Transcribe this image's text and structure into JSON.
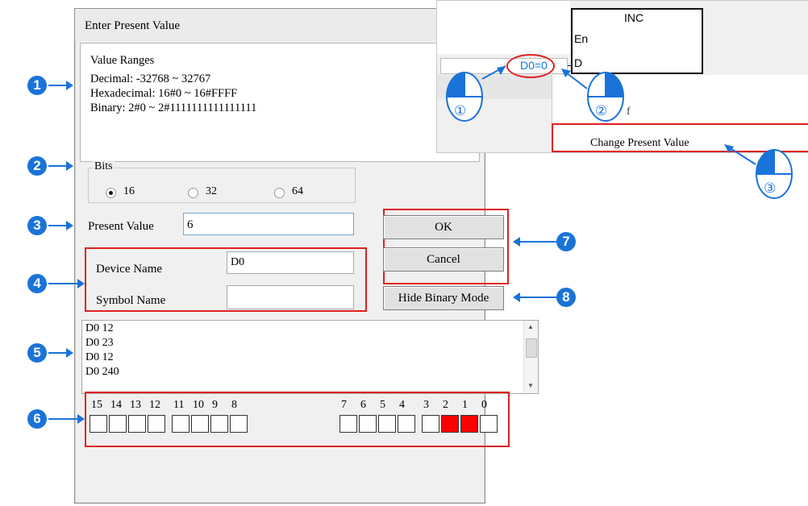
{
  "dialog": {
    "title": "Enter Present Value",
    "value_ranges": {
      "heading": "Value Ranges",
      "decimal": "Decimal: -32768 ~ 32767",
      "hexadecimal": "Hexadecimal: 16#0 ~ 16#FFFF",
      "binary": "Binary: 2#0 ~ 2#1111111111111111"
    },
    "bits": {
      "label": "Bits",
      "options": [
        "16",
        "32",
        "64"
      ],
      "selected": "16"
    },
    "present_value": {
      "label": "Present Value",
      "value": "6"
    },
    "device_name": {
      "label": "Device Name",
      "value": "D0"
    },
    "symbol_name": {
      "label": "Symbol Name",
      "value": ""
    },
    "buttons": {
      "ok": "OK",
      "cancel": "Cancel",
      "hide_binary": "Hide Binary Mode"
    },
    "history": [
      "D0 12",
      "D0 23",
      "D0 12",
      "D0 240"
    ],
    "bit_labels_high": [
      "15",
      "14",
      "13",
      "12",
      "11",
      "10",
      "9",
      "8"
    ],
    "bit_labels_low": [
      "7",
      "6",
      "5",
      "4",
      "3",
      "2",
      "1",
      "0"
    ],
    "bit_values_high": [
      0,
      0,
      0,
      0,
      0,
      0,
      0,
      0
    ],
    "bit_values_low": [
      0,
      0,
      0,
      0,
      0,
      1,
      1,
      0
    ]
  },
  "ladder": {
    "block_name": "INC",
    "pin_en": "En",
    "pin_d": "D",
    "operand": "D0=0",
    "menu_item": "Change Present Value"
  },
  "annotations": {
    "badges": [
      "1",
      "2",
      "3",
      "4",
      "5",
      "6",
      "7",
      "8"
    ],
    "mouse_steps": [
      "①",
      "②",
      "③"
    ]
  },
  "colors": {
    "accent_blue": "#1a73d9",
    "highlight_red": "#e02020",
    "bit_on": "#ff0000"
  }
}
